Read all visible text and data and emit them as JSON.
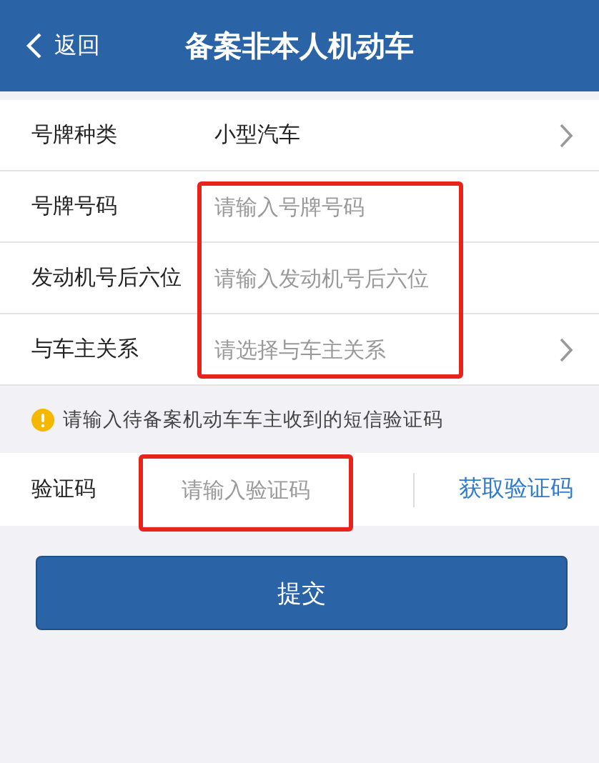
{
  "header": {
    "back": "返回",
    "title": "备案非本人机动车"
  },
  "fields": [
    {
      "label": "号牌种类",
      "value": "小型汽车",
      "chevron": true,
      "highlighted": false
    },
    {
      "label": "号牌号码",
      "placeholder": "请输入号牌号码",
      "chevron": false,
      "highlighted": true
    },
    {
      "label": "发动机号后六位",
      "placeholder": "请输入发动机号后六位",
      "chevron": false,
      "highlighted": true
    },
    {
      "label": "与车主关系",
      "placeholder": "请选择与车主关系",
      "chevron": true,
      "highlighted": true
    }
  ],
  "notice": "请输入待备案机动车车主收到的短信验证码",
  "code": {
    "label": "验证码",
    "placeholder": "请输入验证码",
    "highlighted": true,
    "link": "获取验证码"
  },
  "submit": "提交"
}
